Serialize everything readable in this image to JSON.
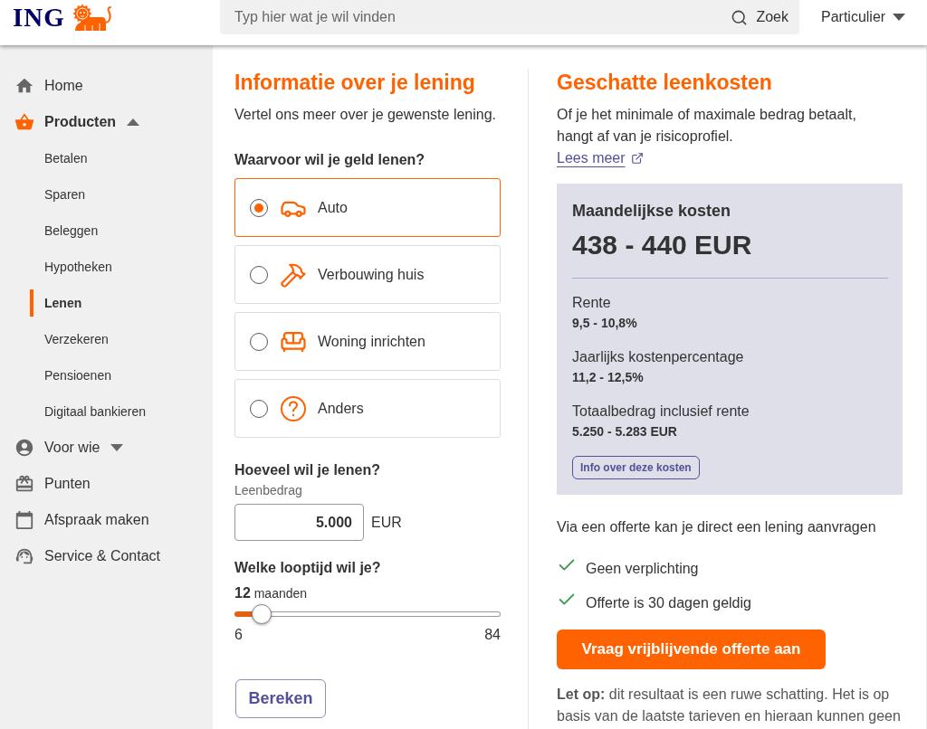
{
  "header": {
    "logo": "ING",
    "search": {
      "placeholder": "Typ hier wat je wil vinden",
      "button": "Zoek"
    },
    "audience": "Particulier"
  },
  "sidebar": {
    "items": [
      {
        "label": "Home",
        "kind": "link",
        "selected": false
      },
      {
        "label": "Producten",
        "kind": "group",
        "selected": true,
        "expanded": true,
        "children": [
          {
            "label": "Betalen",
            "selected": false
          },
          {
            "label": "Sparen",
            "selected": false
          },
          {
            "label": "Beleggen",
            "selected": false
          },
          {
            "label": "Hypotheken",
            "selected": false
          },
          {
            "label": "Lenen",
            "selected": true
          },
          {
            "label": "Verzekeren",
            "selected": false
          },
          {
            "label": "Pensioenen",
            "selected": false
          },
          {
            "label": "Digitaal bankieren",
            "selected": false
          }
        ]
      },
      {
        "label": "Voor wie",
        "kind": "group",
        "selected": false,
        "expanded": false
      },
      {
        "label": "Punten",
        "kind": "link",
        "selected": false
      },
      {
        "label": "Afspraak maken",
        "kind": "link",
        "selected": false
      },
      {
        "label": "Service & Contact",
        "kind": "link",
        "selected": false
      }
    ]
  },
  "loan_form": {
    "title": "Informatie over je lening",
    "intro": "Vertel ons meer over je gewenste lening.",
    "purpose": {
      "label": "Waarvoor wil je geld lenen?",
      "options": [
        {
          "label": "Auto",
          "selected": true
        },
        {
          "label": "Verbouwing huis",
          "selected": false
        },
        {
          "label": "Woning inrichten",
          "selected": false
        },
        {
          "label": "Anders",
          "selected": false
        }
      ]
    },
    "amount": {
      "label": "Hoeveel wil je lenen?",
      "field_label": "Leenbedrag",
      "value": "5.000",
      "unit": "EUR"
    },
    "term": {
      "label": "Welke looptijd wil je?",
      "value": "12",
      "unit": "maanden",
      "level": 0.07,
      "min": "6",
      "max": "84"
    },
    "button": "Bereken"
  },
  "estimate": {
    "title": "Geschatte leenkosten",
    "intro": "Of je het minimale of maximale bedrag betaalt, hangt af van je risicoprofiel.",
    "link": "Lees meer",
    "panel": {
      "label": "Maandelijkse kosten",
      "amount": "438 - 440 EUR",
      "details": [
        {
          "label": "Rente",
          "value": "9,5 - 10,8%"
        },
        {
          "label": "Jaarlijks kostenpercentage",
          "value": "11,2 - 12,5%"
        },
        {
          "label": "Totaalbedrag inclusief rente",
          "value": "5.250 - 5.283 EUR"
        }
      ],
      "button": "Info over deze kosten"
    },
    "offer_intro": "Via een offerte kan je direct een lening aanvragen",
    "benefits": [
      "Geen verplichting",
      "Offerte is 30 dagen geldig"
    ],
    "cta": "Vraag vrijblijvende offerte aan",
    "note": "**Let op:** dit resultaat is een ruwe schatting. Het is op basis van de laatste tarieven en hieraan kunnen geen"
  }
}
